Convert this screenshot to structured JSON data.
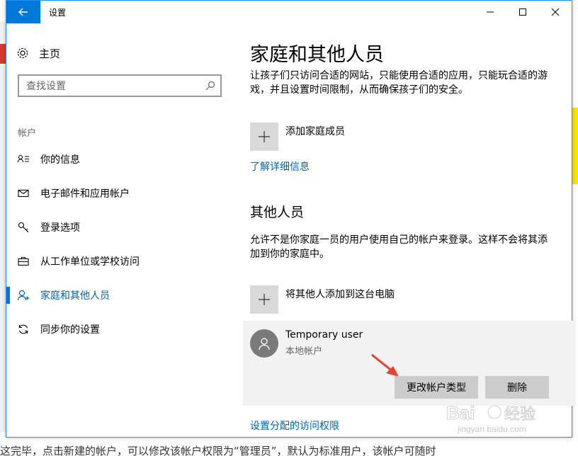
{
  "window": {
    "title": "设置",
    "controls": [
      "minimize-icon",
      "maximize-icon",
      "close-icon"
    ]
  },
  "nav": {
    "home_label": "主页",
    "search_placeholder": "查找设置",
    "section_label": "帐户",
    "items": [
      {
        "label": "你的信息",
        "icon": "person-info-icon",
        "active": false
      },
      {
        "label": "电子邮件和应用帐户",
        "icon": "mail-icon",
        "active": false
      },
      {
        "label": "登录选项",
        "icon": "key-icon",
        "active": false
      },
      {
        "label": "从工作单位或学校访问",
        "icon": "briefcase-icon",
        "active": false
      },
      {
        "label": "家庭和其他人员",
        "icon": "person-icon",
        "active": true
      },
      {
        "label": "同步你的设置",
        "icon": "sync-icon",
        "active": false
      }
    ]
  },
  "content": {
    "title": "家庭和其他人员",
    "description": "让孩子们只访问合适的网站，只能使用合适的应用，只能玩合适的游戏，并且设置时间限制，从而确保孩子们的安全。",
    "add_family_label": "添加家庭成员",
    "learn_more_link": "了解详细信息",
    "other_title": "其他人员",
    "other_description": "允许不是你家庭一员的用户使用自己的帐户来登录。这样不会将其添加到你的家庭中。",
    "add_other_label": "将其他人添加到这台电脑",
    "user": {
      "name": "Temporary user",
      "type": "本地帐户",
      "change_type_button": "更改帐户类型",
      "delete_button": "删除"
    },
    "assigned_access_link": "设置分配的访问权限"
  },
  "background": {
    "bottom_text": "这完毕，点击新建的帐户，可以修改该帐户权限为“管理员”，默认为标准用户，该帐户可随时"
  },
  "watermark": {
    "brand": "Bai经验",
    "url": "jingyan.baidu.com"
  },
  "colors": {
    "accent": "#0078d7",
    "link": "#0063b1",
    "arrow": "#e8402f"
  }
}
